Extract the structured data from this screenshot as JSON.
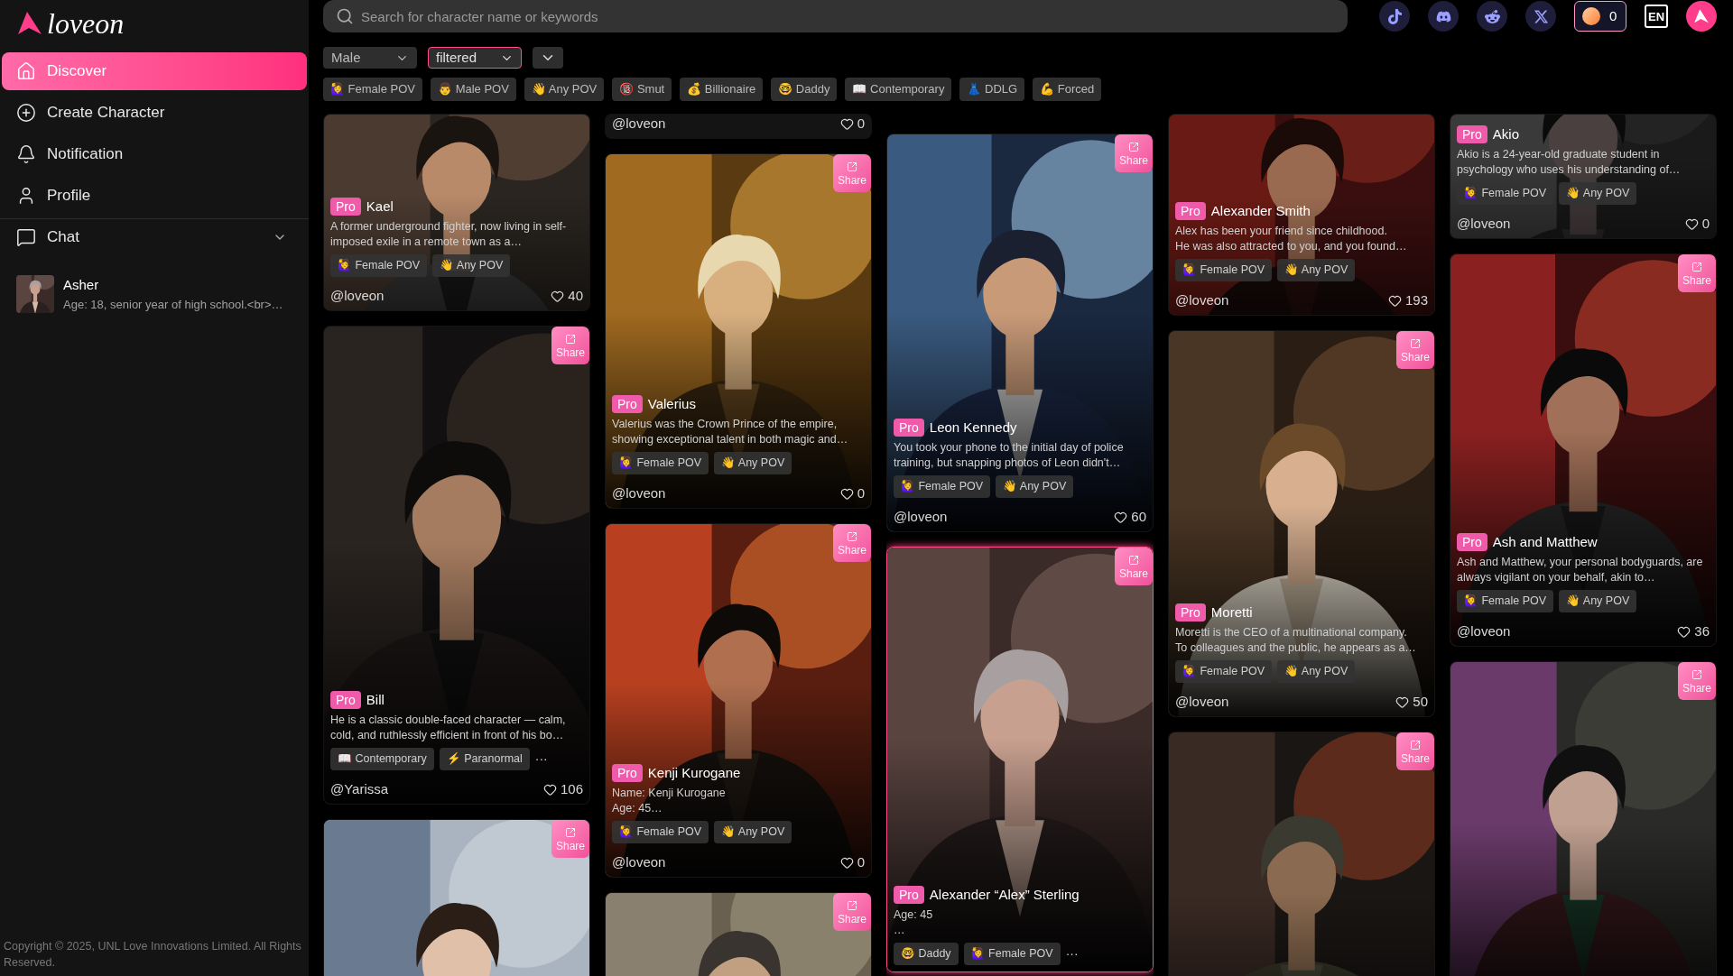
{
  "logo": {
    "text": "loveon"
  },
  "nav": [
    {
      "label": "Discover",
      "selected": true
    },
    {
      "label": "Create Character",
      "selected": false
    },
    {
      "label": "Notification",
      "selected": false
    },
    {
      "label": "Profile",
      "selected": false
    }
  ],
  "chat": {
    "label": "Chat"
  },
  "recent_chats": [
    {
      "name": "Asher",
      "preview": "Age: 18, senior year of high school.<br>…"
    }
  ],
  "copyright": "Copyright © 2025, UNL Love Innovations Limited. All Rights Reserved.",
  "search": {
    "placeholder": "Search for character name or keywords"
  },
  "header_links": [
    {
      "kind": "tiktok"
    },
    {
      "kind": "discord"
    },
    {
      "kind": "reddit"
    },
    {
      "kind": "x"
    }
  ],
  "coins": "0",
  "language": "EN",
  "filters": [
    {
      "value": "Male",
      "highlighted": false
    },
    {
      "value": "filtered",
      "highlighted": true
    }
  ],
  "tags": [
    "🙋‍♀️ Female POV",
    "👨 Male POV",
    "👋 Any POV",
    "🔞 Smut",
    "💰 Billionaire",
    "🤓 Daddy",
    "📖 Contemporary",
    "👗 DDLG",
    "💪 Forced"
  ],
  "columns": [
    [
      {
        "highlighted": false,
        "badge": "Pro",
        "name": "Kael",
        "description": "A former underground fighter, now living in self-imposed exile in a remote town as a…",
        "tags": [
          "🙋‍♀️ Female POV",
          "👋 Any POV"
        ],
        "author": "@loveon",
        "likes": "40"
      },
      {
        "highlighted": false,
        "share": "Share",
        "badge": "Pro",
        "name": "Bill",
        "description": "He is a classic double-faced character — calm, cold, and ruthlessly efficient in front of his bo…",
        "tags": [
          "📖 Contemporary",
          "⚡ Paranormal"
        ],
        "more": "···",
        "author": "@Yarissa",
        "likes": "106"
      },
      {
        "highlighted": false,
        "share": "Share"
      }
    ],
    [
      {
        "highlighted": false,
        "author": "@loveon",
        "likes": "0"
      },
      {
        "highlighted": false,
        "share": "Share",
        "badge": "Pro",
        "name": "Valerius",
        "description": "Valerius was the Crown Prince of the empire, showing exceptional talent in both magic and…",
        "tags": [
          "🙋‍♀️ Female POV",
          "👋 Any POV"
        ],
        "author": "@loveon",
        "likes": "0"
      },
      {
        "highlighted": false,
        "share": "Share",
        "badge": "Pro",
        "name": "Kenji Kurogane",
        "description": "Name: Kenji Kurogane\nAge: 45…",
        "tags": [
          "🙋‍♀️ Female POV",
          "👋 Any POV"
        ],
        "author": "@loveon",
        "likes": "0"
      },
      {
        "highlighted": false,
        "share": "Share"
      }
    ],
    [
      {
        "highlighted": false,
        "share": "Share",
        "badge": "Pro",
        "name": "Leon Kennedy",
        "description": "You took your phone to the initial day of police training, but snapping photos of Leon didn't…",
        "tags": [
          "🙋‍♀️ Female POV",
          "👋 Any POV"
        ],
        "author": "@loveon",
        "likes": "60"
      },
      {
        "highlighted": true,
        "share": "Share",
        "badge": "Pro",
        "name": "Alexander “Alex” Sterling",
        "description": "Age: 45\n…",
        "tags": [
          "🤓 Daddy",
          "🙋‍♀️ Female POV"
        ],
        "more": "···"
      }
    ],
    [
      {
        "highlighted": false,
        "badge": "Pro",
        "name": "Alexander Smith",
        "description": "Alex has been your friend since childhood.\nHe was also attracted to you, and you found…",
        "tags": [
          "🙋‍♀️ Female POV",
          "👋 Any POV"
        ],
        "author": "@loveon",
        "likes": "193"
      },
      {
        "highlighted": false,
        "share": "Share",
        "badge": "Pro",
        "name": "Moretti",
        "description": "Moretti is the CEO of a multinational company.\nTo colleagues and the public, he appears as a…",
        "tags": [
          "🙋‍♀️ Female POV",
          "👋 Any POV"
        ],
        "author": "@loveon",
        "likes": "50"
      },
      {
        "highlighted": false,
        "share": "Share"
      }
    ],
    [
      {
        "highlighted": false,
        "badge": "Pro",
        "name": "Akio",
        "description": "Akio is a 24-year-old graduate student in psychology who uses his understanding of…",
        "tags": [
          "🙋‍♀️ Female POV",
          "👋 Any POV"
        ],
        "author": "@loveon",
        "likes": "0"
      },
      {
        "highlighted": false,
        "share": "Share",
        "badge": "Pro",
        "name": "Ash and Matthew",
        "description": "Ash and Matthew, your personal bodyguards, are always vigilant on your behalf, akin to…",
        "tags": [
          "🙋‍♀️ Female POV",
          "👋 Any POV"
        ],
        "author": "@loveon",
        "likes": "36"
      },
      {
        "highlighted": false,
        "share": "Share"
      }
    ]
  ]
}
